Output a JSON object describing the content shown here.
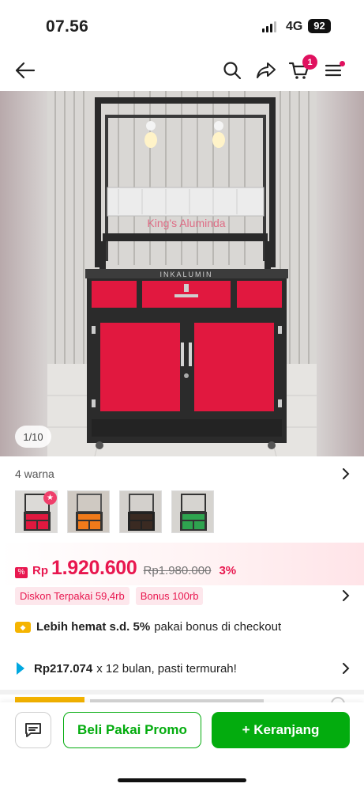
{
  "status_bar": {
    "time": "07.56",
    "network": "4G",
    "battery": "92"
  },
  "nav": {
    "cart_count": "1"
  },
  "gallery": {
    "counter": "1/10",
    "watermark": "King's Aluminda",
    "cabinet_label": "INKALUMIN"
  },
  "variants": {
    "label": "4 warna",
    "thumbnails": [
      {
        "color": "#e1183f",
        "badge": "★"
      },
      {
        "color": "#f07a1a"
      },
      {
        "color": "#3a2a22"
      },
      {
        "color": "#2ea44f"
      }
    ]
  },
  "price": {
    "currency": "Rp",
    "amount": "1.920.600",
    "original": "Rp1.980.000",
    "discount": "3%"
  },
  "promos": {
    "tags": [
      "Diskon Terpakai 59,4rb",
      "Bonus 100rb"
    ]
  },
  "bonus": {
    "bold": "Lebih hemat s.d. 5%",
    "rest": "pakai bonus di checkout"
  },
  "installment": {
    "bold": "Rp217.074",
    "rest": "x 12 bulan, pasti termurah!"
  },
  "actions": {
    "buy_promo": "Beli Pakai Promo",
    "add_cart": "+ Keranjang"
  },
  "colors": {
    "accent_green": "#03ac0e",
    "accent_red": "#e8174f",
    "cabinet_red": "#e1183f"
  }
}
